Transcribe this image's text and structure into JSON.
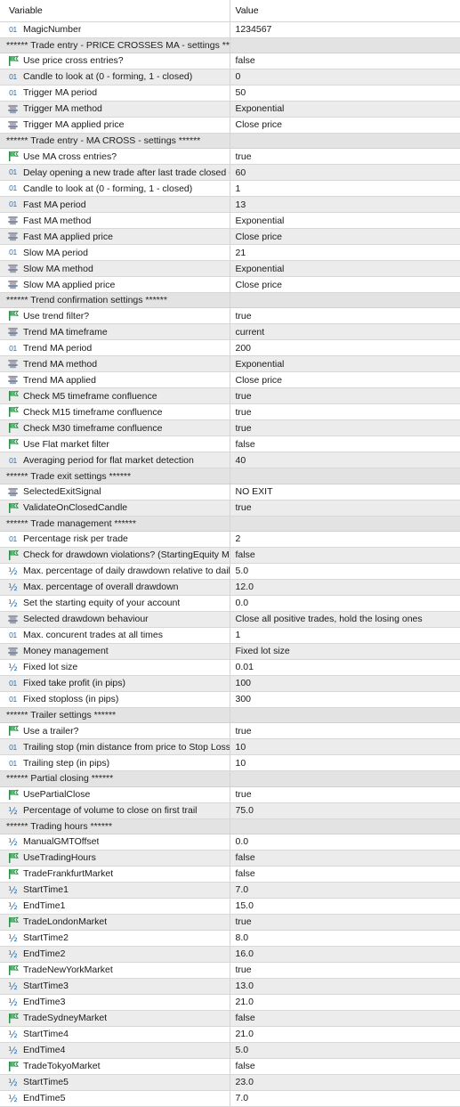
{
  "header": {
    "variable_label": "Variable",
    "value_label": "Value"
  },
  "icons": {
    "int": "integer-01-icon",
    "bool": "boolean-flag-icon",
    "enum": "enum-list-icon",
    "double": "double-half-icon"
  },
  "colors": {
    "row_alt": "#ececec",
    "row_plain": "#ffffff",
    "separator_row": "#e3e3e3",
    "grid_line": "#d8d8d8",
    "icon_blue": "#2f6fa8",
    "icon_green": "#3ba35a"
  },
  "rows": [
    {
      "type": "int",
      "name": "MagicNumber",
      "value": "1234567"
    },
    {
      "type": "sep",
      "name": "****** Trade entry - PRICE CROSSES MA - settings ******",
      "value": ""
    },
    {
      "type": "bool",
      "name": "Use price cross entries?",
      "value": "false"
    },
    {
      "type": "int",
      "name": "Candle to look at (0 - forming, 1 - closed)",
      "value": "0"
    },
    {
      "type": "int",
      "name": "Trigger MA period",
      "value": "50"
    },
    {
      "type": "enum",
      "name": "Trigger MA method",
      "value": "Exponential"
    },
    {
      "type": "enum",
      "name": "Trigger MA applied price",
      "value": "Close price"
    },
    {
      "type": "sep",
      "name": "****** Trade entry - MA CROSS - settings ******",
      "value": ""
    },
    {
      "type": "bool",
      "name": "Use MA cross entries?",
      "value": "true"
    },
    {
      "type": "int",
      "name": "Delay opening a new trade after last trade closed - in ...",
      "value": "60"
    },
    {
      "type": "int",
      "name": "Candle to look at (0 - forming, 1 - closed)",
      "value": "1"
    },
    {
      "type": "int",
      "name": "Fast MA period",
      "value": "13"
    },
    {
      "type": "enum",
      "name": "Fast MA method",
      "value": "Exponential"
    },
    {
      "type": "enum",
      "name": "Fast MA applied price",
      "value": "Close price"
    },
    {
      "type": "int",
      "name": "Slow MA period",
      "value": "21"
    },
    {
      "type": "enum",
      "name": "Slow MA method",
      "value": "Exponential"
    },
    {
      "type": "enum",
      "name": "Slow MA applied price",
      "value": "Close price"
    },
    {
      "type": "sep",
      "name": "****** Trend confirmation settings ******",
      "value": ""
    },
    {
      "type": "bool",
      "name": "Use trend filter?",
      "value": "true"
    },
    {
      "type": "enum",
      "name": "Trend MA timeframe",
      "value": "current"
    },
    {
      "type": "int",
      "name": "Trend MA period",
      "value": "200"
    },
    {
      "type": "enum",
      "name": "Trend MA method",
      "value": "Exponential"
    },
    {
      "type": "enum",
      "name": "Trend MA applied",
      "value": "Close price"
    },
    {
      "type": "bool",
      "name": "Check M5 timeframe confluence",
      "value": "true"
    },
    {
      "type": "bool",
      "name": "Check M15 timeframe confluence",
      "value": "true"
    },
    {
      "type": "bool",
      "name": "Check M30 timeframe confluence",
      "value": "true"
    },
    {
      "type": "bool",
      "name": "Use Flat market filter",
      "value": "false"
    },
    {
      "type": "int",
      "name": "Averaging period for flat market detection",
      "value": "40"
    },
    {
      "type": "sep",
      "name": "****** Trade exit settings ******",
      "value": ""
    },
    {
      "type": "enum",
      "name": "SelectedExitSignal",
      "value": "NO EXIT"
    },
    {
      "type": "bool",
      "name": "ValidateOnClosedCandle",
      "value": "true"
    },
    {
      "type": "sep",
      "name": "****** Trade management ******",
      "value": ""
    },
    {
      "type": "int",
      "name": "Percentage risk per trade",
      "value": "2"
    },
    {
      "type": "bool",
      "name": "Check for drawdown violations? (StartingEquity MUST ...",
      "value": "false"
    },
    {
      "type": "double",
      "name": "Max. percentage of daily drawdown relative to daily e...",
      "value": "5.0"
    },
    {
      "type": "double",
      "name": "Max. percentage of overall drawdown",
      "value": "12.0"
    },
    {
      "type": "double",
      "name": "Set the starting equity of your account",
      "value": "0.0"
    },
    {
      "type": "enum",
      "name": "Selected drawdown behaviour",
      "value": "Close all positive trades, hold the losing ones"
    },
    {
      "type": "int",
      "name": "Max. concurent trades at all times",
      "value": "1"
    },
    {
      "type": "enum",
      "name": "Money management",
      "value": "Fixed lot size"
    },
    {
      "type": "double",
      "name": "Fixed lot size",
      "value": "0.01"
    },
    {
      "type": "int",
      "name": "Fixed take profit (in pips)",
      "value": "100"
    },
    {
      "type": "int",
      "name": "Fixed stoploss (in pips)",
      "value": "300"
    },
    {
      "type": "sep",
      "name": "****** Trailer settings ******",
      "value": ""
    },
    {
      "type": "bool",
      "name": "Use a trailer?",
      "value": "true"
    },
    {
      "type": "int",
      "name": "Trailing stop (min distance from price to Stop Loss) (in ...",
      "value": "10"
    },
    {
      "type": "int",
      "name": "Trailing step (in pips)",
      "value": "10"
    },
    {
      "type": "sep",
      "name": "****** Partial closing ******",
      "value": ""
    },
    {
      "type": "bool",
      "name": "UsePartialClose",
      "value": "true"
    },
    {
      "type": "double",
      "name": "Percentage of volume to close on first trail",
      "value": "75.0"
    },
    {
      "type": "sep",
      "name": "****** Trading hours ******",
      "value": ""
    },
    {
      "type": "double",
      "name": "ManualGMTOffset",
      "value": "0.0"
    },
    {
      "type": "bool",
      "name": "UseTradingHours",
      "value": "false"
    },
    {
      "type": "bool",
      "name": "TradeFrankfurtMarket",
      "value": "false"
    },
    {
      "type": "double",
      "name": "StartTime1",
      "value": "7.0"
    },
    {
      "type": "double",
      "name": "EndTime1",
      "value": "15.0"
    },
    {
      "type": "bool",
      "name": "TradeLondonMarket",
      "value": "true"
    },
    {
      "type": "double",
      "name": "StartTime2",
      "value": "8.0"
    },
    {
      "type": "double",
      "name": "EndTime2",
      "value": "16.0"
    },
    {
      "type": "bool",
      "name": "TradeNewYorkMarket",
      "value": "true"
    },
    {
      "type": "double",
      "name": "StartTime3",
      "value": "13.0"
    },
    {
      "type": "double",
      "name": "EndTime3",
      "value": "21.0"
    },
    {
      "type": "bool",
      "name": "TradeSydneyMarket",
      "value": "false"
    },
    {
      "type": "double",
      "name": "StartTime4",
      "value": "21.0"
    },
    {
      "type": "double",
      "name": "EndTime4",
      "value": "5.0"
    },
    {
      "type": "bool",
      "name": "TradeTokyoMarket",
      "value": "false"
    },
    {
      "type": "double",
      "name": "StartTime5",
      "value": "23.0"
    },
    {
      "type": "double",
      "name": "EndTime5",
      "value": "7.0"
    }
  ]
}
